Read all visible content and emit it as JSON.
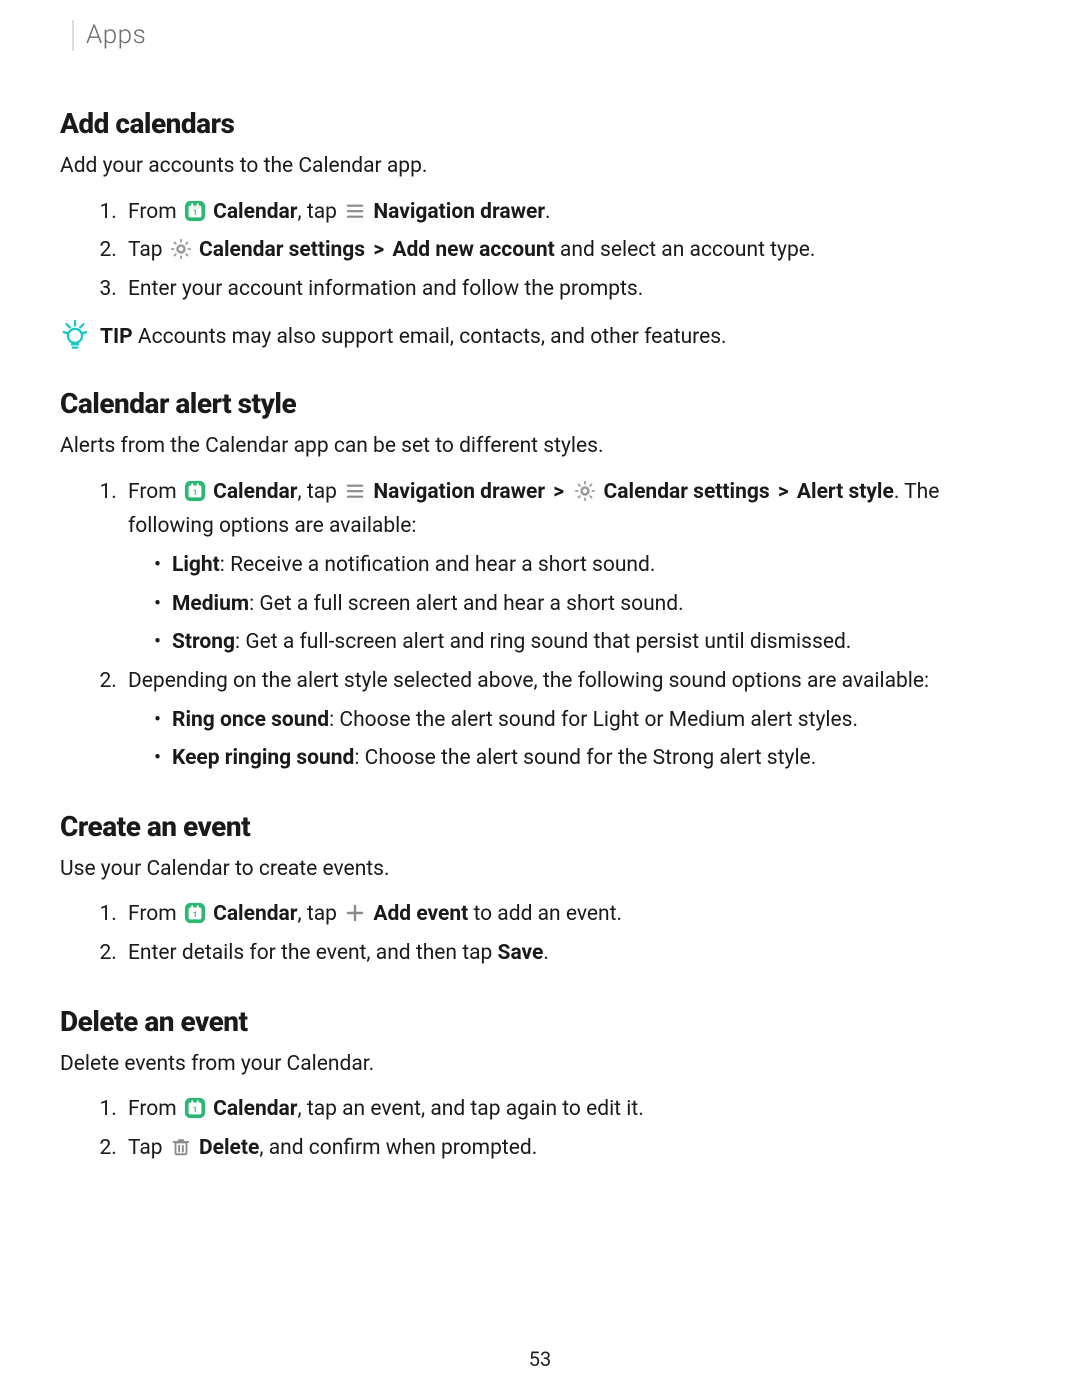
{
  "breadcrumb": "Apps",
  "cal_icon": "calendar-icon",
  "nav_icon": "navigation-drawer-icon",
  "gear_icon": "gear-icon",
  "plus_icon": "plus-icon",
  "trash_icon": "trash-icon",
  "bulb_icon": "lightbulb-tip-icon",
  "s1": {
    "title": "Add calendars",
    "intro": "Add your accounts to the Calendar app.",
    "step1_a": "From ",
    "step1_b": "Calendar",
    "step1_c": ", tap ",
    "step1_d": "Navigation drawer",
    "step1_e": ".",
    "step2_a": "Tap ",
    "step2_b": "Calendar settings",
    "step2_c": "Add new account",
    "step2_d": " and select an account type.",
    "step3": "Enter your account information and follow the prompts.",
    "tip_label": "TIP",
    "tip_text": "  Accounts may also support email, contacts, and other features."
  },
  "s2": {
    "title": "Calendar alert style",
    "intro": "Alerts from the Calendar app can be set to different styles.",
    "step1_a": "From ",
    "step1_b": "Calendar",
    "step1_c": ", tap ",
    "step1_d": "Navigation drawer",
    "step1_e": "Calendar settings",
    "step1_f": "Alert style",
    "step1_g": ". The following options are available:",
    "opt1_b": "Light",
    "opt1_t": ": Receive a notification and hear a short sound.",
    "opt2_b": "Medium",
    "opt2_t": ": Get a full screen alert and hear a short sound.",
    "opt3_b": "Strong",
    "opt3_t": ": Get a full-screen alert and ring sound that persist until dismissed.",
    "step2": "Depending on the alert style selected above, the following sound options are available:",
    "snd1_b": "Ring once sound",
    "snd1_t": ": Choose the alert sound for Light or Medium alert styles.",
    "snd2_b": "Keep ringing sound",
    "snd2_t": ": Choose the alert sound for the Strong alert style."
  },
  "s3": {
    "title": "Create an event",
    "intro": "Use your Calendar to create events.",
    "step1_a": "From ",
    "step1_b": "Calendar",
    "step1_c": ", tap ",
    "step1_d": "Add event",
    "step1_e": " to add an event.",
    "step2_a": "Enter details for the event, and then tap ",
    "step2_b": "Save",
    "step2_c": "."
  },
  "s4": {
    "title": "Delete an event",
    "intro": "Delete events from your Calendar.",
    "step1_a": "From ",
    "step1_b": "Calendar",
    "step1_c": ", tap an event, and tap again to edit it.",
    "step2_a": "Tap ",
    "step2_b": "Delete",
    "step2_c": ", and confirm when prompted."
  },
  "page_number": "53",
  "chev": ">"
}
